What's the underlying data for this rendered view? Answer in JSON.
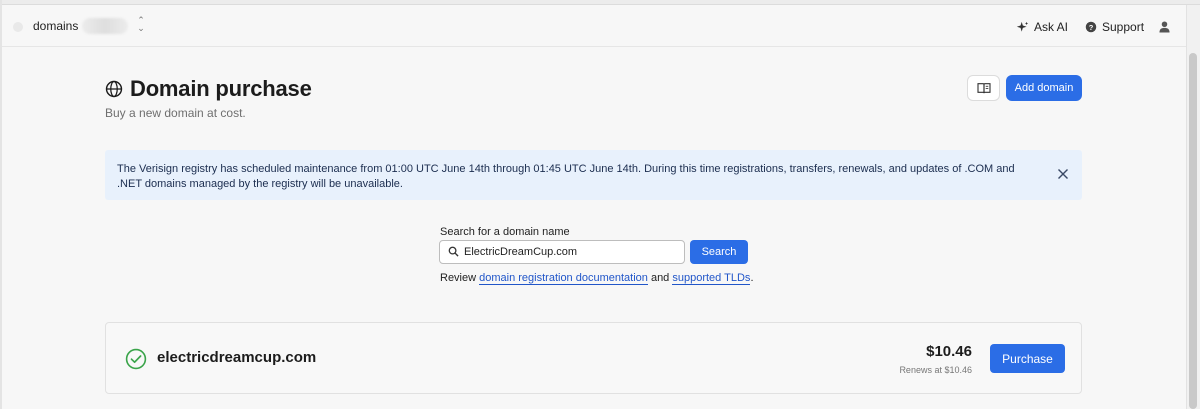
{
  "topbar": {
    "team_name": "domains",
    "ask_ai_label": "Ask AI",
    "support_label": "Support"
  },
  "header": {
    "title": "Domain purchase",
    "subtitle": "Buy a new domain at cost.",
    "add_domain_label": "Add domain"
  },
  "banner": {
    "message": "The Verisign registry has scheduled maintenance from 01:00 UTC June 14th through 01:45 UTC June 14th. During this time registrations, transfers, renewals, and updates of .COM and .NET domains managed by the registry will be unavailable."
  },
  "search": {
    "label": "Search for a domain name",
    "value": "ElectricDreamCup.com",
    "button_label": "Search",
    "review_prefix": "Review ",
    "docs_link": "domain registration documentation",
    "review_and": " and ",
    "tlds_link": "supported TLDs",
    "review_suffix": "."
  },
  "result": {
    "domain": "electricdreamcup.com",
    "price": "$10.46",
    "renews": "Renews at $10.46",
    "purchase_label": "Purchase",
    "status": "available"
  },
  "colors": {
    "accent": "#2b6de6",
    "banner_bg": "#e8f1fc",
    "success": "#3aa44a"
  },
  "icons": {
    "title": "globe-icon",
    "ask_ai": "sparkle-icon",
    "support": "help-circle-icon",
    "user": "user-icon",
    "docs": "book-icon",
    "close": "close-icon",
    "search": "search-icon",
    "check": "check-circle-icon"
  }
}
